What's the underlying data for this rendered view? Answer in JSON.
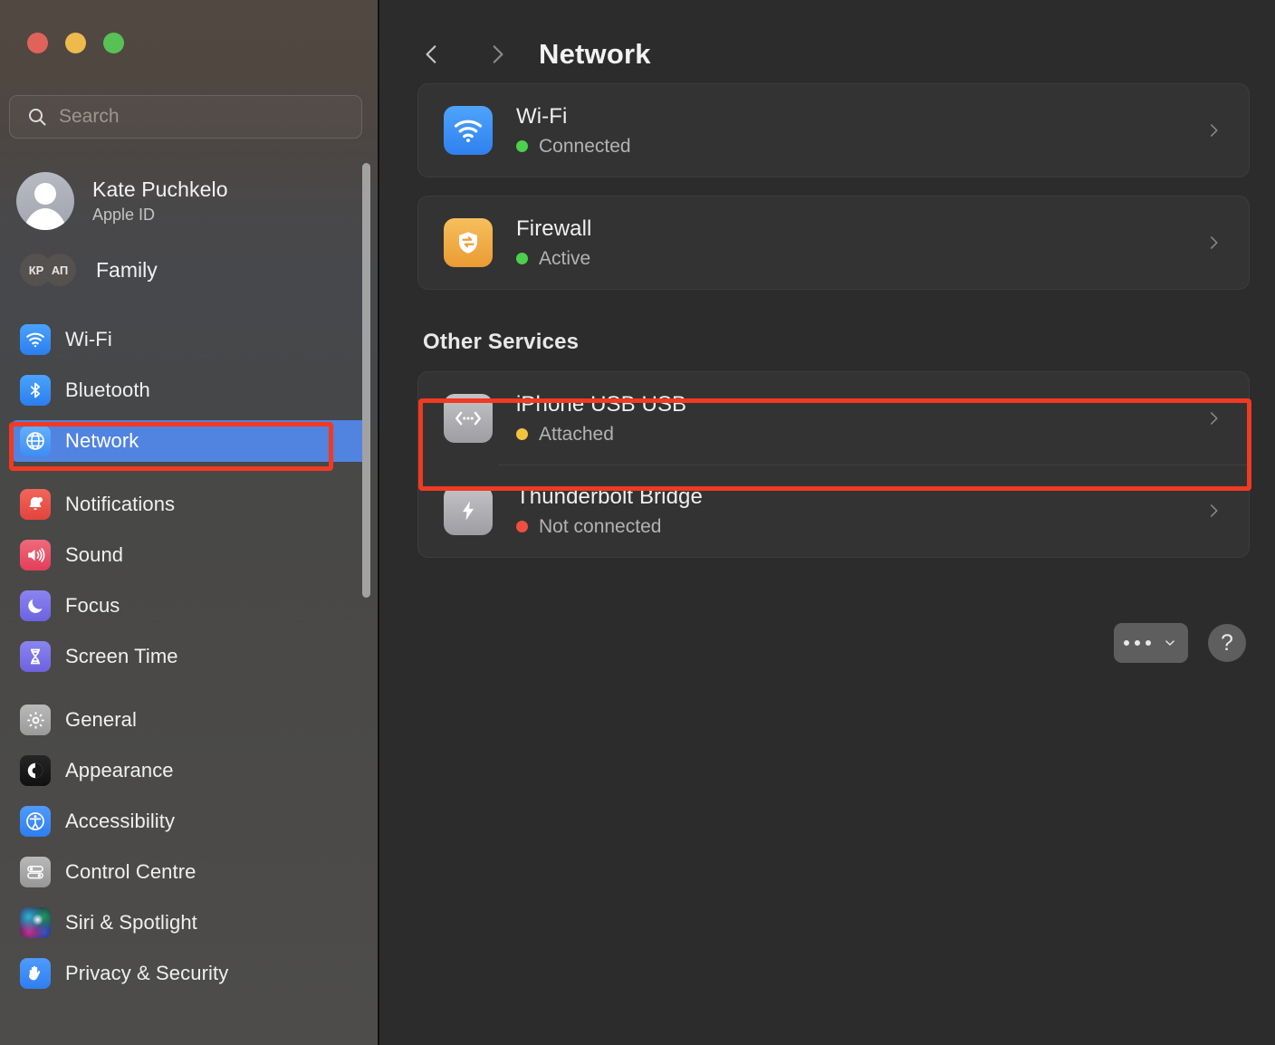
{
  "window": {
    "traffic_lights": [
      "close",
      "minimize",
      "zoom"
    ]
  },
  "sidebar": {
    "search": {
      "placeholder": "Search",
      "value": "",
      "icon": "search-icon"
    },
    "account": {
      "name": "Kate Puchkelo",
      "subtitle": "Apple ID",
      "avatar_icon": "person-avatar"
    },
    "family": {
      "label": "Family",
      "avatars": [
        "КР",
        "АП"
      ]
    },
    "groups": [
      {
        "items": [
          {
            "label": "Wi-Fi",
            "icon": "wifi-icon",
            "icon_class": "g-wifi",
            "selected": false
          },
          {
            "label": "Bluetooth",
            "icon": "bluetooth-icon",
            "icon_class": "g-bt",
            "selected": false
          },
          {
            "label": "Network",
            "icon": "globe-icon",
            "icon_class": "g-net",
            "selected": true
          }
        ]
      },
      {
        "items": [
          {
            "label": "Notifications",
            "icon": "bell-icon",
            "icon_class": "g-notif",
            "selected": false
          },
          {
            "label": "Sound",
            "icon": "speaker-icon",
            "icon_class": "g-sound",
            "selected": false
          },
          {
            "label": "Focus",
            "icon": "moon-icon",
            "icon_class": "g-focus",
            "selected": false
          },
          {
            "label": "Screen Time",
            "icon": "hourglass-icon",
            "icon_class": "g-screen",
            "selected": false
          }
        ]
      },
      {
        "items": [
          {
            "label": "General",
            "icon": "gear-icon",
            "icon_class": "g-general",
            "selected": false
          },
          {
            "label": "Appearance",
            "icon": "contrast-icon",
            "icon_class": "g-appear",
            "selected": false
          },
          {
            "label": "Accessibility",
            "icon": "accessibility-icon",
            "icon_class": "g-access",
            "selected": false
          },
          {
            "label": "Control Centre",
            "icon": "sliders-icon",
            "icon_class": "g-control",
            "selected": false
          },
          {
            "label": "Siri & Spotlight",
            "icon": "siri-orb-icon",
            "icon_class": "g-siri",
            "selected": false
          },
          {
            "label": "Privacy & Security",
            "icon": "hand-icon",
            "icon_class": "g-privacy",
            "selected": false
          }
        ]
      }
    ]
  },
  "content": {
    "back_icon": "chevron-left-icon",
    "forward_icon": "chevron-right-icon",
    "title": "Network",
    "primary_services": [
      {
        "name": "Wi-Fi",
        "status": "Connected",
        "status_color": "#4bd14b",
        "icon": "wifi-icon",
        "icon_class": "ic-wifi"
      },
      {
        "name": "Firewall",
        "status": "Active",
        "status_color": "#4bd14b",
        "icon": "firewall-shield-icon",
        "icon_class": "ic-firewall"
      }
    ],
    "other_services_title": "Other Services",
    "other_services": [
      {
        "name": "iPhone USB USB",
        "status": "Attached",
        "status_color": "#f2c43d",
        "icon": "ethernet-icon",
        "icon_class": "ic-grey",
        "highlighted": true
      },
      {
        "name": "Thunderbolt Bridge",
        "status": "Not connected",
        "status_color": "#ef4f3e",
        "icon": "thunderbolt-icon",
        "icon_class": "ic-grey",
        "highlighted": false
      }
    ],
    "footer": {
      "more_menu_label": "•••",
      "more_menu_icon": "ellipsis-chevron-icon",
      "help_label": "?",
      "help_icon": "question-mark-icon"
    }
  },
  "annotations": {
    "accent_color": "#f03a22",
    "boxes": [
      {
        "target": "sidebar-item-network"
      },
      {
        "target": "service-row-iphone-usb"
      }
    ]
  }
}
